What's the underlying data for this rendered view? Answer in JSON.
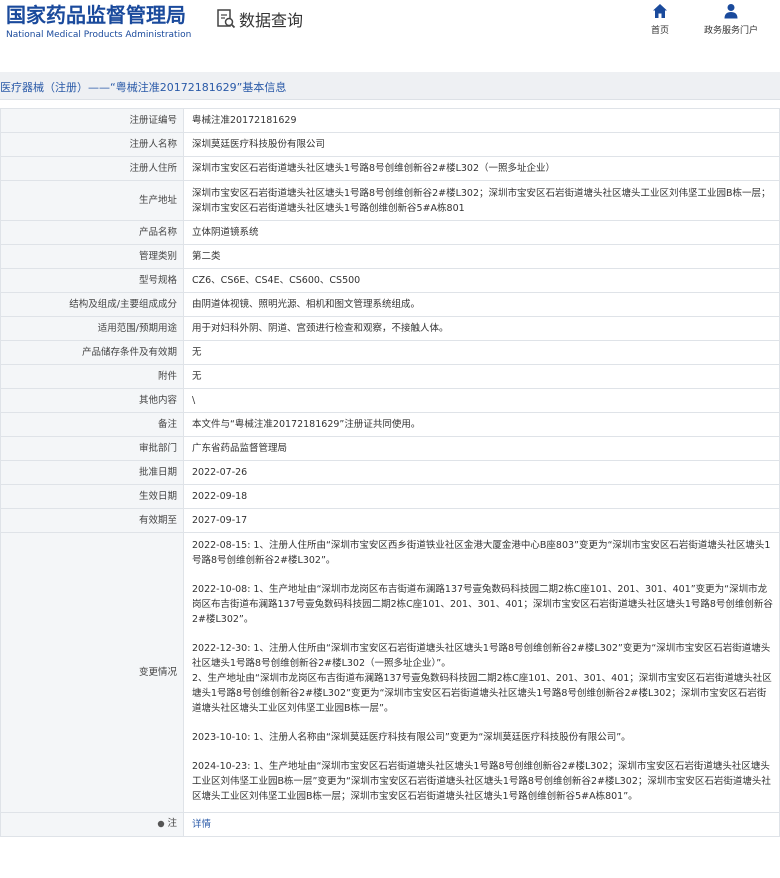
{
  "header": {
    "logo_cn": "国家药品监督管理局",
    "logo_en": "National Medical Products Administration",
    "search_title": "数据查询",
    "nav_home": "首页",
    "nav_service": "政务服务门户"
  },
  "page_title": "医疗器械（注册）——“粤械注准20172181629”基本信息",
  "rows": {
    "reg_no": {
      "label": "注册证编号",
      "value": "粤械注准20172181629"
    },
    "registrant": {
      "label": "注册人名称",
      "value": "深圳莫廷医疗科技股份有限公司"
    },
    "registrant_addr": {
      "label": "注册人住所",
      "value": "深圳市宝安区石岩街道塘头社区塘头1号路8号创维创新谷2#楼L302（一照多址企业）"
    },
    "production_addr": {
      "label": "生产地址",
      "value": "深圳市宝安区石岩街道塘头社区塘头1号路8号创维创新谷2#楼L302；深圳市宝安区石岩街道塘头社区塘头工业区刘伟坚工业园B栋一层；深圳市宝安区石岩街道塘头社区塘头1号路创维创新谷5#A栋801"
    },
    "product_name": {
      "label": "产品名称",
      "value": "立体阴道镜系统"
    },
    "category": {
      "label": "管理类别",
      "value": "第二类"
    },
    "model": {
      "label": "型号规格",
      "value": "CZ6、CS6E、CS4E、CS600、CS500"
    },
    "structure": {
      "label": "结构及组成/主要组成成分",
      "value": "由阴道体视镜、照明光源、相机和图文管理系统组成。"
    },
    "scope": {
      "label": "适用范围/预期用途",
      "value": "用于对妇科外阴、阴道、宫颈进行检查和观察，不接触人体。"
    },
    "storage": {
      "label": "产品储存条件及有效期",
      "value": "无"
    },
    "attachment": {
      "label": "附件",
      "value": "无"
    },
    "other": {
      "label": "其他内容",
      "value": "\\"
    },
    "remark": {
      "label": "备注",
      "value": "本文件与“粤械注准20172181629”注册证共同使用。"
    },
    "approval_dept": {
      "label": "审批部门",
      "value": "广东省药品监督管理局"
    },
    "approval_date": {
      "label": "批准日期",
      "value": "2022-07-26"
    },
    "effective_date": {
      "label": "生效日期",
      "value": "2022-09-18"
    },
    "valid_until": {
      "label": "有效期至",
      "value": "2027-09-17"
    },
    "changes": {
      "label": "变更情况",
      "entries": [
        "2022-08-15: 1、注册人住所由“深圳市宝安区西乡街道铁业社区金港大厦金港中心B座803”变更为“深圳市宝安区石岩街道塘头社区塘头1号路8号创维创新谷2#楼L302”。",
        "2022-10-08: 1、生产地址由“深圳市龙岗区布吉街道布澜路137号壹兔数码科技园二期2栋C座101、201、301、401”变更为“深圳市龙岗区布吉街道布澜路137号壹兔数码科技园二期2栋C座101、201、301、401；深圳市宝安区石岩街道塘头社区塘头1号路8号创维创新谷2#楼L302”。",
        "2022-12-30: 1、注册人住所由“深圳市宝安区石岩街道塘头社区塘头1号路8号创维创新谷2#楼L302”变更为“深圳市宝安区石岩街道塘头社区塘头1号路8号创维创新谷2#楼L302（一照多址企业）”。",
        "2、生产地址由“深圳市龙岗区布吉街道布澜路137号壹兔数码科技园二期2栋C座101、201、301、401；深圳市宝安区石岩街道塘头社区塘头1号路8号创维创新谷2#楼L302”变更为“深圳市宝安区石岩街道塘头社区塘头1号路8号创维创新谷2#楼L302；深圳市宝安区石岩街道塘头社区塘头工业区刘伟坚工业园B栋一层”。",
        "2023-10-10: 1、注册人名称由“深圳莫廷医疗科技有限公司”变更为“深圳莫廷医疗科技股份有限公司”。",
        "2024-10-23: 1、生产地址由“深圳市宝安区石岩街道塘头社区塘头1号路8号创维创新谷2#楼L302；深圳市宝安区石岩街道塘头社区塘头工业区刘伟坚工业园B栋一层”变更为“深圳市宝安区石岩街道塘头社区塘头1号路8号创维创新谷2#楼L302；深圳市宝安区石岩街道塘头社区塘头工业区刘伟坚工业园B栋一层；深圳市宝安区石岩街道塘头社区塘头1号路创维创新谷5#A栋801”。"
      ]
    },
    "note": {
      "label": "注",
      "value": "详情"
    }
  }
}
